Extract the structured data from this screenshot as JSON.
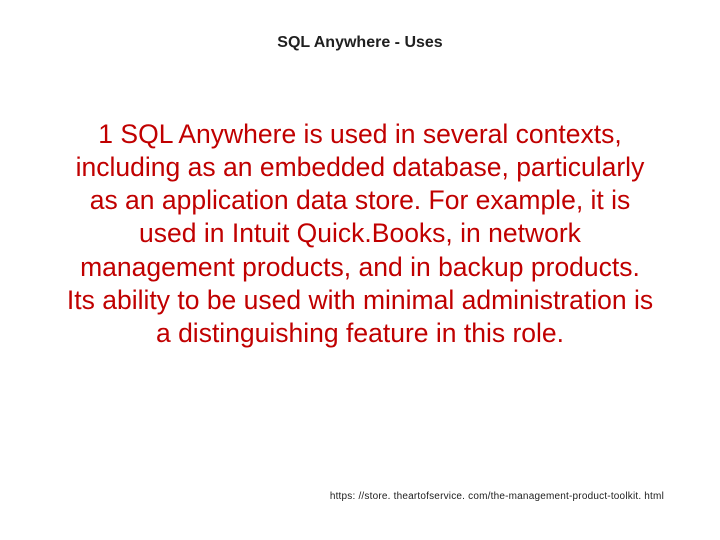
{
  "title": "SQL Anywhere -  Uses",
  "counter": "1",
  "body": "SQL Anywhere is used in several contexts, including as an embedded database, particularly as an application data store. For example, it is used in Intuit Quick.Books, in network management products, and in backup products. Its ability to be used with minimal administration is a distinguishing feature in this role.",
  "footer_url": "https: //store. theartofservice. com/the-management-product-toolkit. html"
}
